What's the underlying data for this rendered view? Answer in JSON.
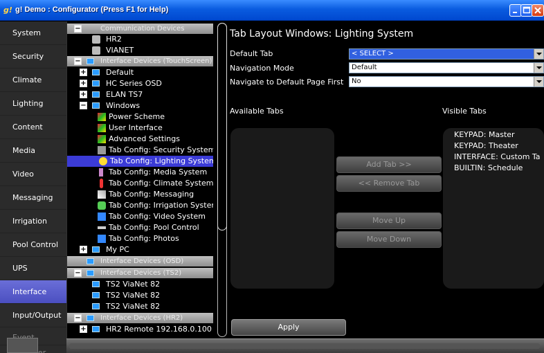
{
  "window": {
    "title": "g! Demo : Configurator   (Press F1 for Help)",
    "app_icon_glyph": "g!"
  },
  "sidebar": {
    "items": [
      {
        "label": "System"
      },
      {
        "label": "Security"
      },
      {
        "label": "Climate"
      },
      {
        "label": "Lighting"
      },
      {
        "label": "Content"
      },
      {
        "label": "Media"
      },
      {
        "label": "Video"
      },
      {
        "label": "Messaging"
      },
      {
        "label": "Irrigation"
      },
      {
        "label": "Pool Control"
      },
      {
        "label": "UPS"
      },
      {
        "label": "Interface"
      },
      {
        "label": "Input/Output"
      }
    ],
    "active": "Interface",
    "bottom_partial": "Event Manager"
  },
  "tree": {
    "headers": [
      {
        "label": "Communication Devices"
      },
      {
        "label": "Interface Devices (TouchScreen)"
      },
      {
        "label": "Interface Devices (OSD)"
      },
      {
        "label": "Interface Devices (TS2)"
      },
      {
        "label": "Interface Devices (HR2)"
      }
    ],
    "rows": [
      {
        "label": "HR2"
      },
      {
        "label": "VIANET"
      },
      {
        "label": "Default"
      },
      {
        "label": "HC Series OSD"
      },
      {
        "label": "ELAN TS7"
      },
      {
        "label": "Windows"
      },
      {
        "label": "Power Scheme"
      },
      {
        "label": "User Interface"
      },
      {
        "label": "Advanced Settings"
      },
      {
        "label": "Tab Config: Security System"
      },
      {
        "label": "Tab Config: Lighting System"
      },
      {
        "label": "Tab Config: Media System"
      },
      {
        "label": "Tab Config: Climate System"
      },
      {
        "label": "Tab Config: Messaging"
      },
      {
        "label": "Tab Config: Irrigation System"
      },
      {
        "label": "Tab Config: Video System"
      },
      {
        "label": "Tab Config: Pool Control"
      },
      {
        "label": "Tab Config: Photos"
      },
      {
        "label": "My PC"
      },
      {
        "label": "TS2 ViaNet 82"
      },
      {
        "label": "TS2 ViaNet 82"
      },
      {
        "label": "TS2 ViaNet 82"
      },
      {
        "label": "HR2 Remote 192.168.0.100"
      }
    ],
    "selected": "Tab Config: Lighting System"
  },
  "main": {
    "title": "Tab Layout Windows: Lighting System",
    "default_tab_label": "Default Tab",
    "default_tab_value": "< SELECT >",
    "nav_mode_label": "Navigation Mode",
    "nav_mode_value": "Default",
    "nav_default_label": "Navigate to Default Page First",
    "nav_default_value": "No",
    "available_tabs_label": "Available Tabs",
    "visible_tabs_label": "Visible Tabs",
    "visible_tabs": [
      "KEYPAD: Master",
      "KEYPAD: Theater",
      "INTERFACE: Custom Ta",
      "BUILTIN: Schedule"
    ],
    "add_tab_label": "Add Tab >>",
    "remove_tab_label": "<< Remove Tab",
    "move_up_label": "Move Up",
    "move_down_label": "Move Down",
    "apply_label": "Apply"
  },
  "colors": {
    "titlebar": "#0a5ce0",
    "selection": "#3b3bd6",
    "sidebar_active": "#5a5ecf"
  }
}
